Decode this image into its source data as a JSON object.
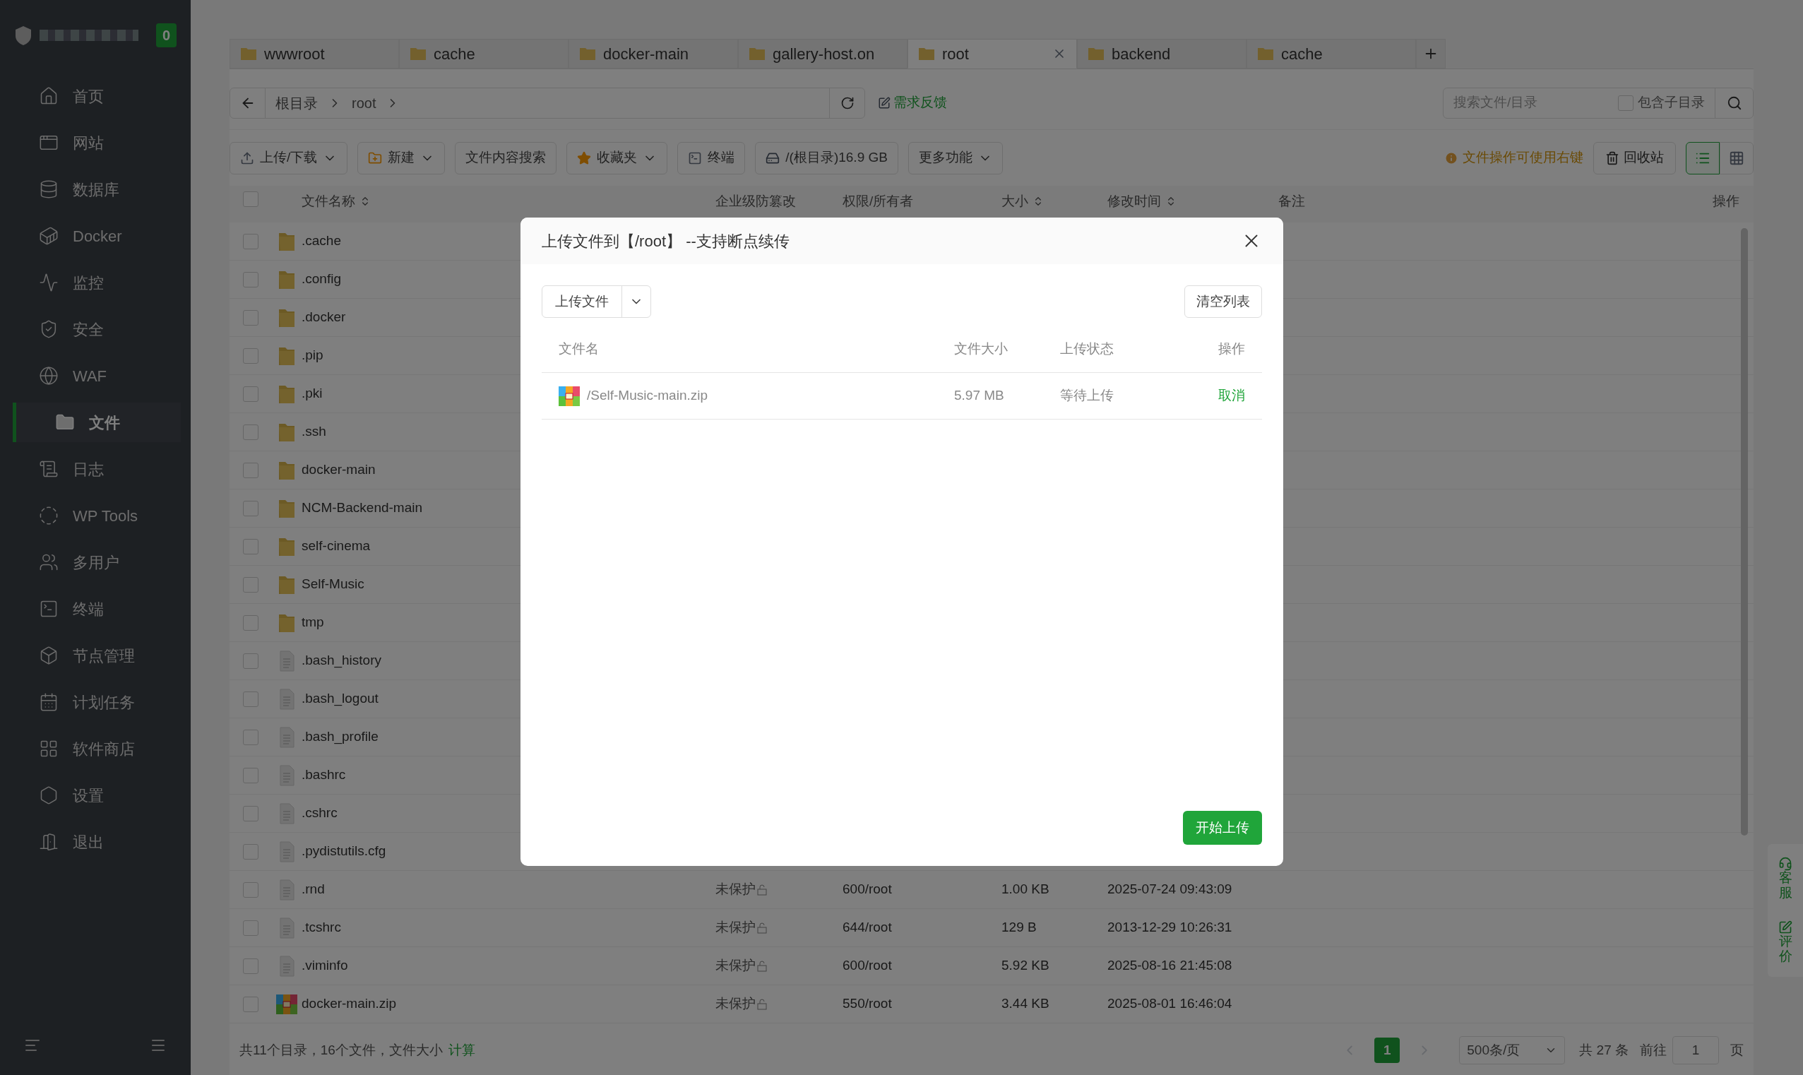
{
  "sidebar": {
    "badge": "0",
    "items": [
      {
        "label": "首页",
        "selected": false
      },
      {
        "label": "网站",
        "selected": false
      },
      {
        "label": "数据库",
        "selected": false
      },
      {
        "label": "Docker",
        "selected": false
      },
      {
        "label": "监控",
        "selected": false
      },
      {
        "label": "安全",
        "selected": false
      },
      {
        "label": "WAF",
        "selected": false
      },
      {
        "label": "文件",
        "selected": true
      },
      {
        "label": "日志",
        "selected": false
      },
      {
        "label": "WP Tools",
        "selected": false
      },
      {
        "label": "多用户",
        "selected": false
      },
      {
        "label": "终端",
        "selected": false
      },
      {
        "label": "节点管理",
        "selected": false
      },
      {
        "label": "计划任务",
        "selected": false
      },
      {
        "label": "软件商店",
        "selected": false
      },
      {
        "label": "设置",
        "selected": false
      },
      {
        "label": "退出",
        "selected": false
      }
    ]
  },
  "tabs": [
    {
      "label": "wwwroot",
      "selected": false
    },
    {
      "label": "cache",
      "selected": false
    },
    {
      "label": "docker-main",
      "selected": false
    },
    {
      "label": "gallery-host.on",
      "selected": false
    },
    {
      "label": "root",
      "selected": true
    },
    {
      "label": "backend",
      "selected": false
    },
    {
      "label": "cache",
      "selected": false
    }
  ],
  "breadcrumb": [
    "根目录",
    "root"
  ],
  "feedback": "需求反馈",
  "search": {
    "placeholder": "搜索文件/目录",
    "include_subdirs": {
      "label": "包含子目录",
      "checked": false
    }
  },
  "toolbar": [
    {
      "label": "上传/下载",
      "dropdown": true
    },
    {
      "label": "新建",
      "dropdown": true
    },
    {
      "label": "文件内容搜索",
      "dropdown": false
    },
    {
      "label": "收藏夹",
      "dropdown": true
    },
    {
      "label": "终端",
      "dropdown": false
    },
    {
      "label": "/(根目录)16.9 GB",
      "dropdown": false
    },
    {
      "label": "更多功能",
      "dropdown": true
    }
  ],
  "hint": "文件操作可使用右键",
  "recycle_bin": "回收站",
  "views": [
    {
      "kind": "list",
      "selected": true
    },
    {
      "kind": "grid",
      "selected": false
    }
  ],
  "table": {
    "select_all": {
      "checked": false
    },
    "columns": [
      "文件名称",
      "企业级防篡改",
      "权限/所有者",
      "大小",
      "修改时间",
      "备注",
      "操作"
    ],
    "rows": [
      {
        "name": ".cache",
        "kind": "folder",
        "checked": false
      },
      {
        "name": ".config",
        "kind": "folder",
        "checked": false
      },
      {
        "name": ".docker",
        "kind": "folder",
        "checked": false
      },
      {
        "name": ".pip",
        "kind": "folder",
        "checked": false
      },
      {
        "name": ".pki",
        "kind": "folder",
        "checked": false
      },
      {
        "name": ".ssh",
        "kind": "folder",
        "checked": false
      },
      {
        "name": "docker-main",
        "kind": "folder",
        "checked": false
      },
      {
        "name": "NCM-Backend-main",
        "kind": "folder",
        "checked": false
      },
      {
        "name": "self-cinema",
        "kind": "folder",
        "checked": false
      },
      {
        "name": "Self-Music",
        "kind": "folder",
        "checked": false
      },
      {
        "name": "tmp",
        "kind": "folder",
        "checked": false
      },
      {
        "name": ".bash_history",
        "kind": "file",
        "checked": false
      },
      {
        "name": ".bash_logout",
        "kind": "file",
        "checked": false
      },
      {
        "name": ".bash_profile",
        "kind": "file",
        "checked": false
      },
      {
        "name": ".bashrc",
        "kind": "file",
        "checked": false
      },
      {
        "name": ".cshrc",
        "kind": "file",
        "checked": false
      },
      {
        "name": ".pydistutils.cfg",
        "kind": "file",
        "checked": false
      },
      {
        "name": ".rnd",
        "kind": "file",
        "checked": false,
        "protection": "未保护",
        "permission": "600/root",
        "size": "1.00 KB",
        "modified": "2025-07-24 09:43:09"
      },
      {
        "name": ".tcshrc",
        "kind": "file",
        "checked": false,
        "protection": "未保护",
        "permission": "644/root",
        "size": "129 B",
        "modified": "2013-12-29 10:26:31"
      },
      {
        "name": ".viminfo",
        "kind": "file",
        "checked": false,
        "protection": "未保护",
        "permission": "600/root",
        "size": "5.92 KB",
        "modified": "2025-08-16 21:45:08"
      },
      {
        "name": "docker-main.zip",
        "kind": "archive",
        "checked": false,
        "protection": "未保护",
        "permission": "550/root",
        "size": "3.44 KB",
        "modified": "2025-08-01 16:46:04"
      }
    ]
  },
  "footer": {
    "summary": "共11个目录，16个文件，文件大小",
    "calculate": "计算",
    "pages": [
      {
        "label": "1",
        "selected": true
      }
    ],
    "page_size": "500条/页",
    "total": "共 27 条",
    "goto": "前往",
    "goto_value": "1",
    "page_unit": "页"
  },
  "float_buttons": [
    "客服",
    "评价"
  ],
  "dialog": {
    "title": "上传文件到【/root】 --支持断点续传",
    "upload_button": "上传文件",
    "clear_button": "清空列表",
    "columns": [
      "文件名",
      "文件大小",
      "上传状态",
      "操作"
    ],
    "rows": [
      {
        "name": "/Self-Music-main.zip",
        "size": "5.97 MB",
        "status": "等待上传",
        "action": "取消"
      }
    ],
    "start_button": "开始上传"
  }
}
